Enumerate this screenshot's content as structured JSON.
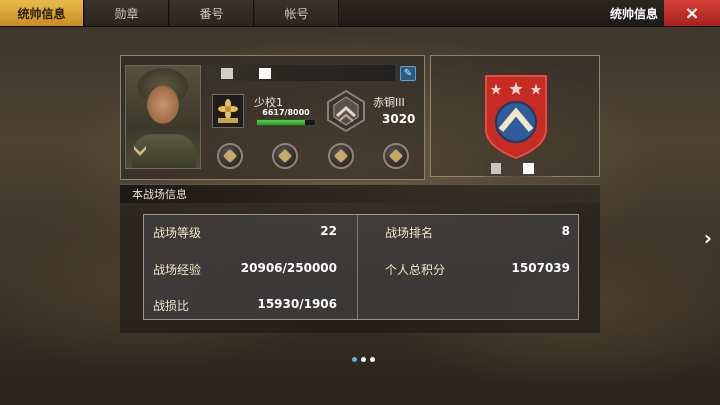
{
  "tabs": [
    {
      "label": "统帅信息",
      "active": true
    },
    {
      "label": "勋章",
      "active": false
    },
    {
      "label": "番号",
      "active": false
    },
    {
      "label": "帐号",
      "active": false
    }
  ],
  "header": {
    "title": "统帅信息",
    "close_icon": "×"
  },
  "profile": {
    "rank_label": "少校1",
    "exp_text": "6617/8000",
    "exp_progress": 0.827,
    "tier_label": "赤铜III",
    "tier_score": "3020",
    "edit_icon": "✎"
  },
  "battle": {
    "title": "本战场信息",
    "stats": [
      {
        "label": "战场等级",
        "value": "22"
      },
      {
        "label": "战场排名",
        "value": "8"
      },
      {
        "label": "战场经验",
        "value": "20906/250000"
      },
      {
        "label": "个人总积分",
        "value": "1507039"
      },
      {
        "label": "战损比",
        "value": "15930/1906"
      }
    ]
  },
  "navigation": {
    "next_icon": "›",
    "page_count": 3,
    "active_page": 0
  },
  "colors": {
    "accent": "#e9b94c",
    "close": "#c8302a",
    "exp_bar": "#3ccb33",
    "emblem_red": "#c82a24",
    "emblem_blue": "#2f5d9c"
  }
}
